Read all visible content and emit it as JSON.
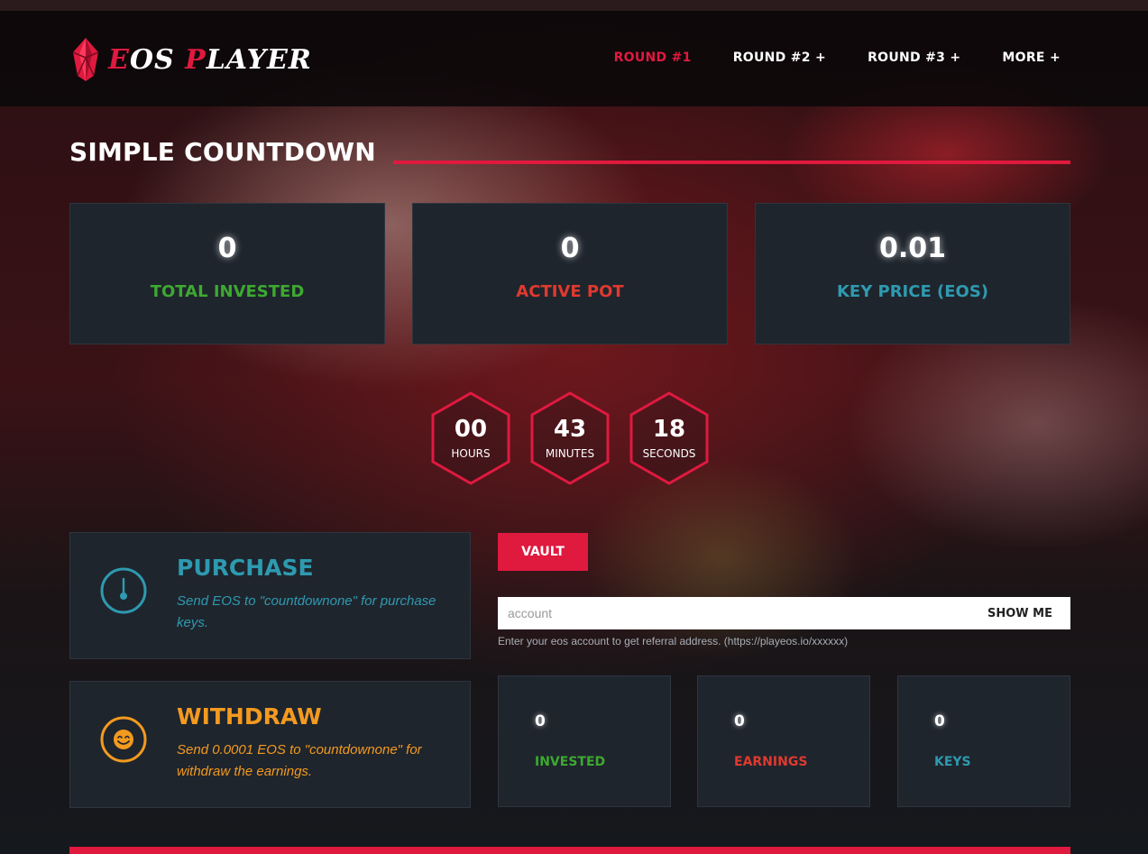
{
  "colors": {
    "accent": "#e0193f",
    "green": "#3da930",
    "red": "#e0392f",
    "teal": "#2e9ab0",
    "orange": "#f39a1f",
    "card_bg": "#1f252d"
  },
  "logo": {
    "first_letter": "E",
    "first_rest": "OS ",
    "second_letter": "P",
    "second_rest": "LAYER",
    "icon": "eos-crystal-icon"
  },
  "nav": {
    "round1": "ROUND #1",
    "round2": "ROUND #2 +",
    "round3": "ROUND #3 +",
    "more": "MORE +"
  },
  "page_title": "SIMPLE COUNTDOWN",
  "stats": {
    "total_invested": {
      "value": "0",
      "label": "TOTAL INVESTED"
    },
    "active_pot": {
      "value": "0",
      "label": "ACTIVE POT"
    },
    "key_price": {
      "value": "0.01",
      "label": "KEY PRICE (EOS)"
    }
  },
  "countdown": {
    "hours": {
      "value": "00",
      "unit": "HOURS"
    },
    "minutes": {
      "value": "43",
      "unit": "MINUTES"
    },
    "seconds": {
      "value": "18",
      "unit": "SECONDS"
    }
  },
  "purchase": {
    "title": "PURCHASE",
    "text": "Send EOS to \"countdownone\" for purchase keys.",
    "icon": "thermometer-icon"
  },
  "withdraw": {
    "title": "WITHDRAW",
    "text": "Send 0.0001 EOS to \"countdownone\" for withdraw the earnings.",
    "icon": "smiley-icon"
  },
  "vault": {
    "button": "VAULT",
    "placeholder": "account",
    "show_me": "SHOW ME",
    "hint": "Enter your eos account to get referral address. (https://playeos.io/xxxxxx)"
  },
  "personal": {
    "invested": {
      "value": "0",
      "label": "INVESTED"
    },
    "earnings": {
      "value": "0",
      "label": "EARNINGS"
    },
    "keys": {
      "value": "0",
      "label": "KEYS"
    }
  }
}
